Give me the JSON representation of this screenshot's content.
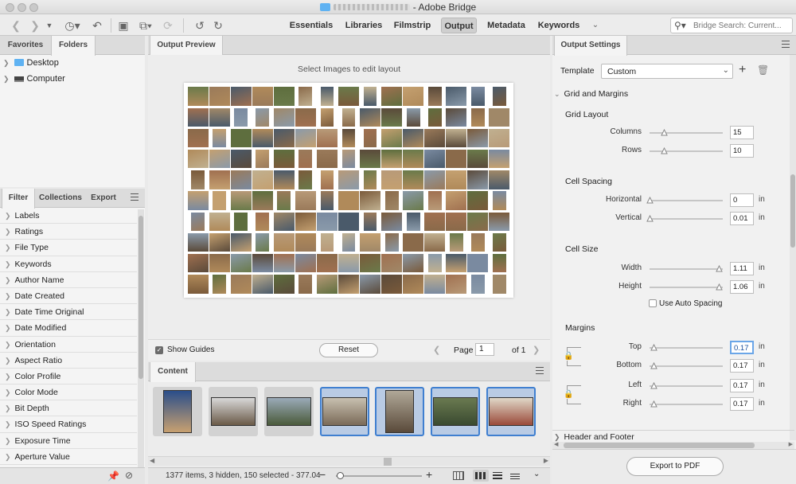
{
  "window": {
    "title_suffix": "- Adobe Bridge"
  },
  "workspaces": {
    "tabs": [
      "Essentials",
      "Libraries",
      "Filmstrip",
      "Output",
      "Metadata",
      "Keywords"
    ],
    "active": "Output"
  },
  "search": {
    "placeholder": "Bridge Search: Current..."
  },
  "left_top_panel": {
    "tabs": [
      "Favorites",
      "Folders"
    ],
    "active": "Folders",
    "items": [
      "Desktop",
      "Computer"
    ]
  },
  "left_bottom_panel": {
    "tabs": [
      "Filter",
      "Collections",
      "Export"
    ],
    "active": "Filter",
    "items": [
      "Labels",
      "Ratings",
      "File Type",
      "Keywords",
      "Author Name",
      "Date Created",
      "Date Time Original",
      "Date Modified",
      "Orientation",
      "Aspect Ratio",
      "Color Profile",
      "Color Mode",
      "Bit Depth",
      "ISO Speed Ratings",
      "Exposure Time",
      "Aperture Value"
    ]
  },
  "output_preview": {
    "tab": "Output Preview",
    "hint": "Select Images to edit layout",
    "show_guides_label": "Show Guides",
    "show_guides_checked": true,
    "reset_label": "Reset",
    "page_label": "Page",
    "page_value": "1",
    "page_of": "of 1"
  },
  "content": {
    "tab": "Content"
  },
  "status": {
    "text": "1377 items, 3 hidden, 150 selected - 377.04"
  },
  "output_settings": {
    "tab": "Output Settings",
    "template_label": "Template",
    "template_value": "Custom",
    "sections": {
      "grid_margins": "Grid and Margins",
      "header_footer": "Header and Footer"
    },
    "grid_layout": {
      "heading": "Grid Layout",
      "columns_label": "Columns",
      "columns_value": "15",
      "rows_label": "Rows",
      "rows_value": "10"
    },
    "cell_spacing": {
      "heading": "Cell Spacing",
      "horizontal_label": "Horizontal",
      "horizontal_value": "0",
      "vertical_label": "Vertical",
      "vertical_value": "0.01"
    },
    "cell_size": {
      "heading": "Cell Size",
      "width_label": "Width",
      "width_value": "1.11",
      "height_label": "Height",
      "height_value": "1.06",
      "auto_spacing_label": "Use Auto Spacing",
      "auto_spacing_checked": false
    },
    "margins": {
      "heading": "Margins",
      "top_label": "Top",
      "top_value": "0.17",
      "bottom_label": "Bottom",
      "bottom_value": "0.17",
      "left_label": "Left",
      "left_value": "0.17",
      "right_label": "Right",
      "right_value": "0.17"
    },
    "unit": "in",
    "export_label": "Export to PDF"
  },
  "colors": {
    "accent": "#3f7fd0",
    "folder_icon": "#5fb2f2"
  }
}
